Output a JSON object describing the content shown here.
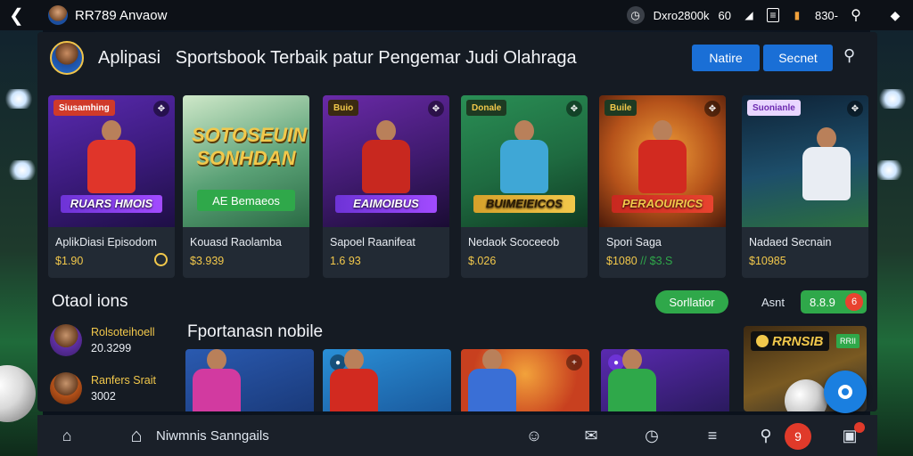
{
  "statusbar": {
    "app_name": "RR789 Anvaow",
    "status_text": "Dxro2800k",
    "status_short": "60",
    "battery_text": "830-",
    "icons": [
      "back-icon",
      "avatar",
      "clock-icon",
      "signal-icon",
      "card-icon",
      "battery-icon",
      "search-icon",
      "location-icon"
    ]
  },
  "header": {
    "title_app": "Aplipasi",
    "title": "Sportsbook Terbaik patur Pengemar Judi Olahraga",
    "button_1": "Natire",
    "button_2": "Secnet"
  },
  "cards": [
    {
      "tag": "Siusamhing",
      "banner": "RUARS HMOIS",
      "name": "AplikDiasi Episodom",
      "price": "$1.90"
    },
    {
      "tag": "",
      "banner": "SOTOSEUIN SONHDAN",
      "banner_button": "AE Bemaeos",
      "name": "Kouasd Raolamba",
      "price": "$3.939"
    },
    {
      "tag": "Buio",
      "banner": "EAIMOIBUS",
      "name": "Sapoel Raanifeat",
      "price": "1.6 93"
    },
    {
      "tag": "Donale",
      "banner": "BUIMEIEICOS",
      "name": "Nedaok Scoceeob",
      "price": "$.026"
    },
    {
      "tag": "Buile",
      "banner": "PERAOUIRICS",
      "name": "Spori Saga",
      "price": "$1080",
      "price_extra": "// $3.S"
    },
    {
      "tag": "Suonianle",
      "banner": "",
      "name": "Nadaed Secnain",
      "price": "$10985"
    }
  ],
  "section": {
    "title": "Otaol ions",
    "subscribe_button": "Sorllatior",
    "account_label": "Asnt",
    "account_value": "8.8.9",
    "account_badge": "6"
  },
  "list": [
    {
      "line1": "Rolsoteihoell",
      "line2": "20.3299"
    },
    {
      "line1": "Ranfers Srait",
      "line2": "3002"
    }
  ],
  "mobile": {
    "title": "Fportanasn nobile"
  },
  "promo": {
    "tag": "RRNSIB",
    "small_tag": "RRII"
  },
  "bottom_nav": {
    "label": "Niwmnis Sanngails",
    "badge": "9"
  },
  "colors": {
    "accent_blue": "#1a6fd6",
    "accent_green": "#2fa84a",
    "price_gold": "#f2c84b",
    "badge_red": "#e03a2a"
  }
}
